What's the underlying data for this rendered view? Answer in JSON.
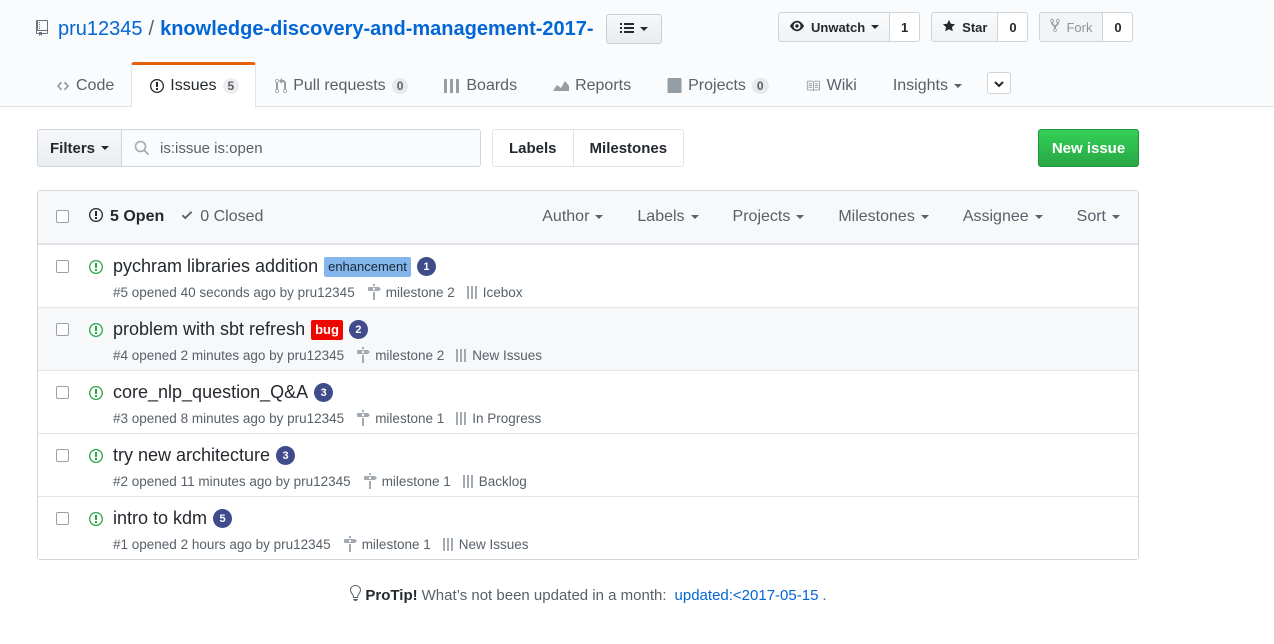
{
  "repo": {
    "owner": "pru12345",
    "separator": "/",
    "name": "knowledge-discovery-and-management-2017-"
  },
  "actions": {
    "watch_label": "Unwatch",
    "watch_count": "1",
    "star_label": "Star",
    "star_count": "0",
    "fork_label": "Fork",
    "fork_count": "0"
  },
  "nav": {
    "code": "Code",
    "issues": "Issues",
    "issues_count": "5",
    "pulls": "Pull requests",
    "pulls_count": "0",
    "boards": "Boards",
    "reports": "Reports",
    "projects": "Projects",
    "projects_count": "0",
    "wiki": "Wiki",
    "insights": "Insights"
  },
  "toolbar": {
    "filters_label": "Filters",
    "search_value": "is:issue is:open",
    "labels_label": "Labels",
    "milestones_label": "Milestones",
    "new_issue_label": "New issue"
  },
  "list_header": {
    "open_label": "5 Open",
    "closed_label": "0 Closed",
    "filters": [
      "Author",
      "Labels",
      "Projects",
      "Milestones",
      "Assignee",
      "Sort"
    ]
  },
  "issues": [
    {
      "title": "pychram libraries addition",
      "label": "enhancement",
      "badge": "1",
      "meta": "#5 opened 40 seconds ago by pru12345",
      "milestone": "milestone 2",
      "column": "Icebox"
    },
    {
      "title": "problem with sbt refresh",
      "label": "bug",
      "badge": "2",
      "meta": "#4 opened 2 minutes ago by pru12345",
      "milestone": "milestone 2",
      "column": "New Issues"
    },
    {
      "title": "core_nlp_question_Q&A",
      "label": "",
      "badge": "3",
      "meta": "#3 opened 8 minutes ago by pru12345",
      "milestone": "milestone 1",
      "column": "In Progress"
    },
    {
      "title": "try new architecture",
      "label": "",
      "badge": "3",
      "meta": "#2 opened 11 minutes ago by pru12345",
      "milestone": "milestone 1",
      "column": "Backlog"
    },
    {
      "title": "intro to kdm",
      "label": "",
      "badge": "5",
      "meta": "#1 opened 2 hours ago by pru12345",
      "milestone": "milestone 1",
      "column": "New Issues"
    }
  ],
  "protip": {
    "label": "ProTip!",
    "text": "What’s not been updated in a month:",
    "link": "updated:<2017-05-15",
    "end": "."
  },
  "colors": {
    "link": "#0366d6",
    "green": "#28a745",
    "bug_label": "#ee0701",
    "enhancement_label": "#84b6eb",
    "badge": "#3f4b8a",
    "nav_selected_accent": "#e36209"
  }
}
